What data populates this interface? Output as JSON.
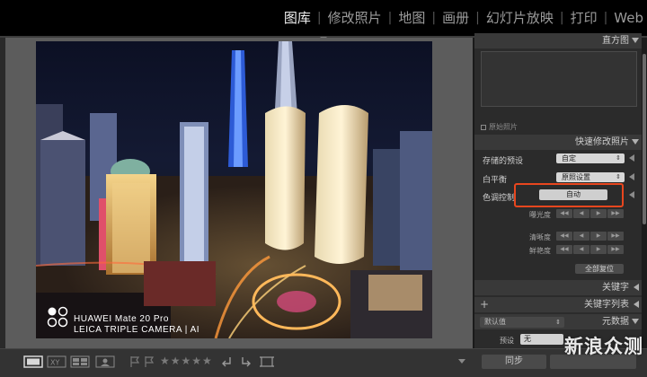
{
  "modules": [
    "图库",
    "修改照片",
    "地图",
    "画册",
    "幻灯片放映",
    "打印",
    "Web"
  ],
  "active_module": "图库",
  "photo": {
    "camera_line1": "HUAWEI Mate 20 Pro",
    "camera_line2": "LEICA TRIPLE CAMERA | AI"
  },
  "panels": {
    "histogram": "直方图",
    "original_photo": "原始照片",
    "quick_develop": "快速修改照片",
    "keywords": "关键字",
    "keyword_list": "关键字列表",
    "metadata": "元数据"
  },
  "quick_develop": {
    "saved_preset_label": "存储的预设",
    "saved_preset_value": "自定",
    "white_balance_label": "白平衡",
    "white_balance_value": "原照设置",
    "tone_control_label": "色调控制",
    "auto_button": "自动",
    "exposure_label": "曝光度",
    "clarity_label": "清晰度",
    "vibrance_label": "鲜艳度",
    "reset_all": "全部复位"
  },
  "metadata": {
    "view_value": "默认值",
    "preset_label": "预设",
    "preset_value": "无"
  },
  "toolbar": {
    "rating": "★★★★★",
    "sync_button": "同步"
  },
  "watermark": "新浪众测",
  "colors": {
    "highlight_box": "#e8461e",
    "active_module": "#f2f2f2",
    "inactive_module": "#9a9a9a"
  }
}
